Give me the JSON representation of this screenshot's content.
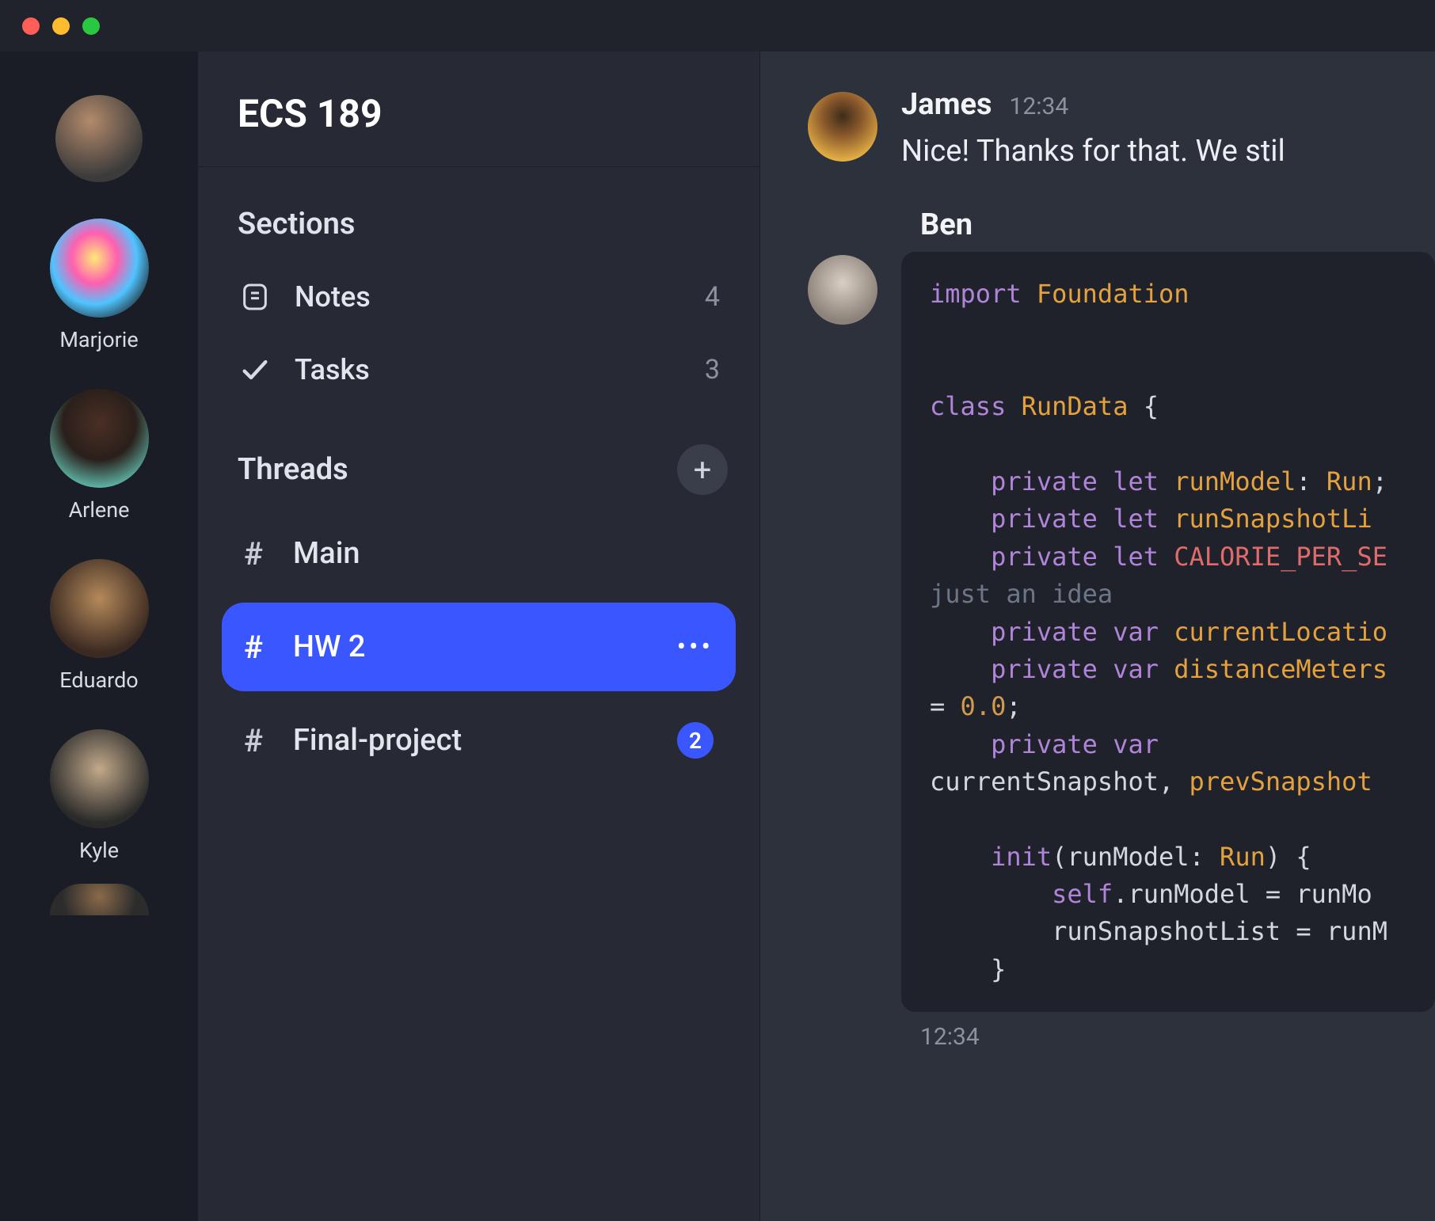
{
  "window": {
    "close": "close",
    "minimize": "minimize",
    "maximize": "maximize"
  },
  "servers": [
    {
      "name": ""
    },
    {
      "name": "Marjorie"
    },
    {
      "name": "Arlene"
    },
    {
      "name": "Eduardo"
    },
    {
      "name": "Kyle"
    },
    {
      "name": ""
    }
  ],
  "workspace": {
    "title": "ECS 189"
  },
  "sections_heading": "Sections",
  "sections": [
    {
      "icon": "notes",
      "label": "Notes",
      "count": "4"
    },
    {
      "icon": "check",
      "label": "Tasks",
      "count": "3"
    }
  ],
  "threads_heading": "Threads",
  "add_button": "+",
  "threads": [
    {
      "label": "Main",
      "active": false,
      "badge": "",
      "more": ""
    },
    {
      "label": "HW 2",
      "active": true,
      "badge": "",
      "more": "•••"
    },
    {
      "label": "Final-project",
      "active": false,
      "badge": "2",
      "more": ""
    }
  ],
  "messages": {
    "james": {
      "author": "James",
      "time": "12:34",
      "text": "Nice! Thanks for that. We stil"
    },
    "ben": {
      "author": "Ben",
      "time_below": "12:34",
      "code": {
        "l01_import": "import",
        "l01_module": "Foundation",
        "l03_class": "class",
        "l03_name": "RunData",
        "l03_brace": "{",
        "l05_priv": "private let",
        "l05_name": "runModel",
        "l05_colon": ":",
        "l05_type": "Run",
        "l06_priv": "private let",
        "l06_name": "runSnapshotLi",
        "l07_priv": "private let",
        "l07_name": "CALORIE_PER_SE",
        "l08_comment": "just an idea",
        "l09_priv": "private var",
        "l09_name": "currentLocatio",
        "l10_priv": "private var",
        "l10_name": "distanceMeters",
        "l11_eq": "=",
        "l11_num": "0.0",
        "l11_semi": ";",
        "l12_priv": "private var",
        "l13_a": "currentSnapshot",
        "l13_comma": ",",
        "l13_b": "prevSnapshot",
        "l15_init": "init",
        "l15_open": "(",
        "l15_param": "runModel",
        "l15_colon": ":",
        "l15_type": "Run",
        "l15_close": ")",
        "l15_brace": "{",
        "l16_self": "self",
        "l16_dot": ".runModel = runMo",
        "l17_a": "runSnapshotList = runM",
        "l18_brace": "}"
      }
    }
  }
}
